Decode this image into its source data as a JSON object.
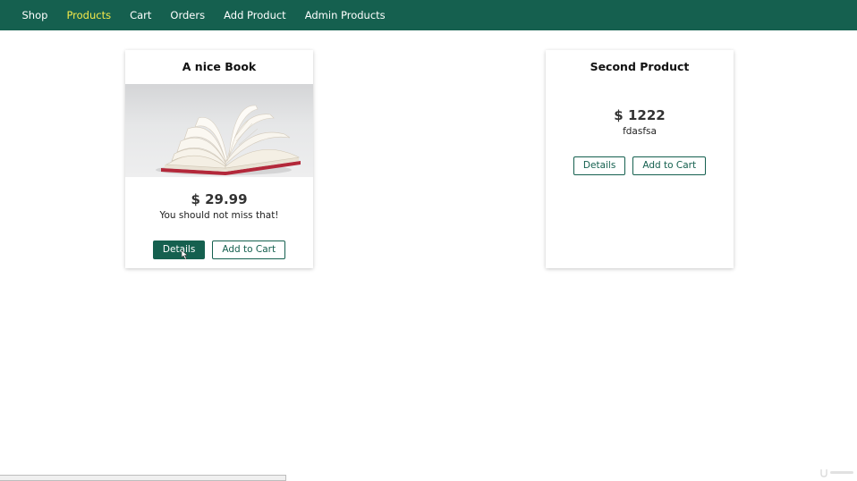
{
  "nav": {
    "items": [
      {
        "label": "Shop",
        "active": false
      },
      {
        "label": "Products",
        "active": true
      },
      {
        "label": "Cart",
        "active": false
      },
      {
        "label": "Orders",
        "active": false
      },
      {
        "label": "Add Product",
        "active": false
      },
      {
        "label": "Admin Products",
        "active": false
      }
    ]
  },
  "products": [
    {
      "title": "A nice Book",
      "price": "$ 29.99",
      "description": "You should not miss that!",
      "has_image": true,
      "details_label": "Details",
      "add_to_cart_label": "Add to Cart"
    },
    {
      "title": "Second Product",
      "price": "$ 1222",
      "description": "fdasfsa",
      "has_image": false,
      "details_label": "Details",
      "add_to_cart_label": "Add to Cart"
    }
  ],
  "colors": {
    "primary": "#15604f",
    "nav_active": "#f4e94a",
    "nav_text": "#ffffff"
  },
  "icons": {
    "cursor": "pointer-cursor-icon",
    "watermark": "udemy-logo-icon",
    "book_image": "open-book-image"
  }
}
